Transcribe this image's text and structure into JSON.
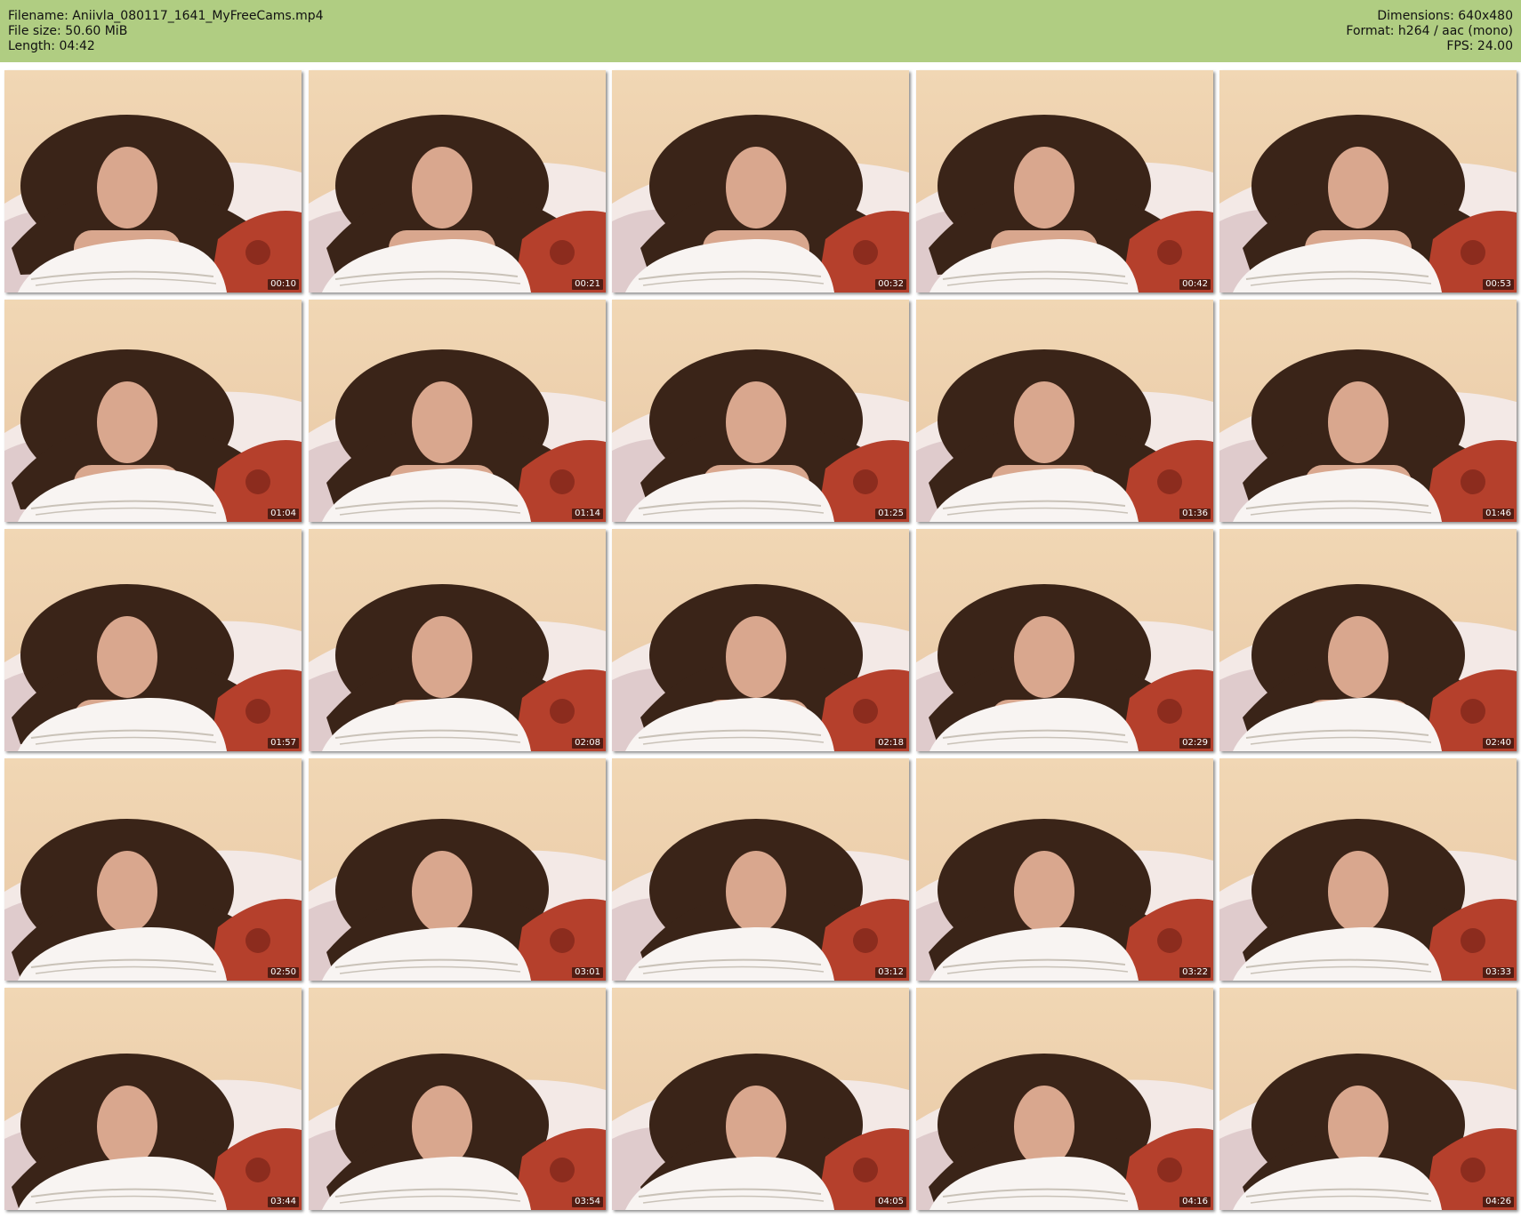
{
  "header": {
    "left": [
      "Filename: Aniivla_080117_1641_MyFreeCams.mp4",
      "File size: 50.60 MiB",
      "Length: 04:42"
    ],
    "right": [
      "Dimensions: 640x480",
      "Format: h264 / aac (mono)",
      "FPS: 24.00"
    ]
  },
  "colors": {
    "header_bg": "#b0cd82",
    "wall": "#e8c8a6",
    "pillow": "#f3e9e6",
    "hair": "#3a2418",
    "skin": "#d9a78e",
    "blanket": "#b5402c"
  },
  "thumbnails": [
    {
      "time": "00:10"
    },
    {
      "time": "00:21"
    },
    {
      "time": "00:32"
    },
    {
      "time": "00:42"
    },
    {
      "time": "00:53"
    },
    {
      "time": "01:04"
    },
    {
      "time": "01:14"
    },
    {
      "time": "01:25"
    },
    {
      "time": "01:36"
    },
    {
      "time": "01:46"
    },
    {
      "time": "01:57"
    },
    {
      "time": "02:08"
    },
    {
      "time": "02:18"
    },
    {
      "time": "02:29"
    },
    {
      "time": "02:40"
    },
    {
      "time": "02:50"
    },
    {
      "time": "03:01"
    },
    {
      "time": "03:12"
    },
    {
      "time": "03:22"
    },
    {
      "time": "03:33"
    },
    {
      "time": "03:44"
    },
    {
      "time": "03:54"
    },
    {
      "time": "04:05"
    },
    {
      "time": "04:16"
    },
    {
      "time": "04:26"
    }
  ]
}
